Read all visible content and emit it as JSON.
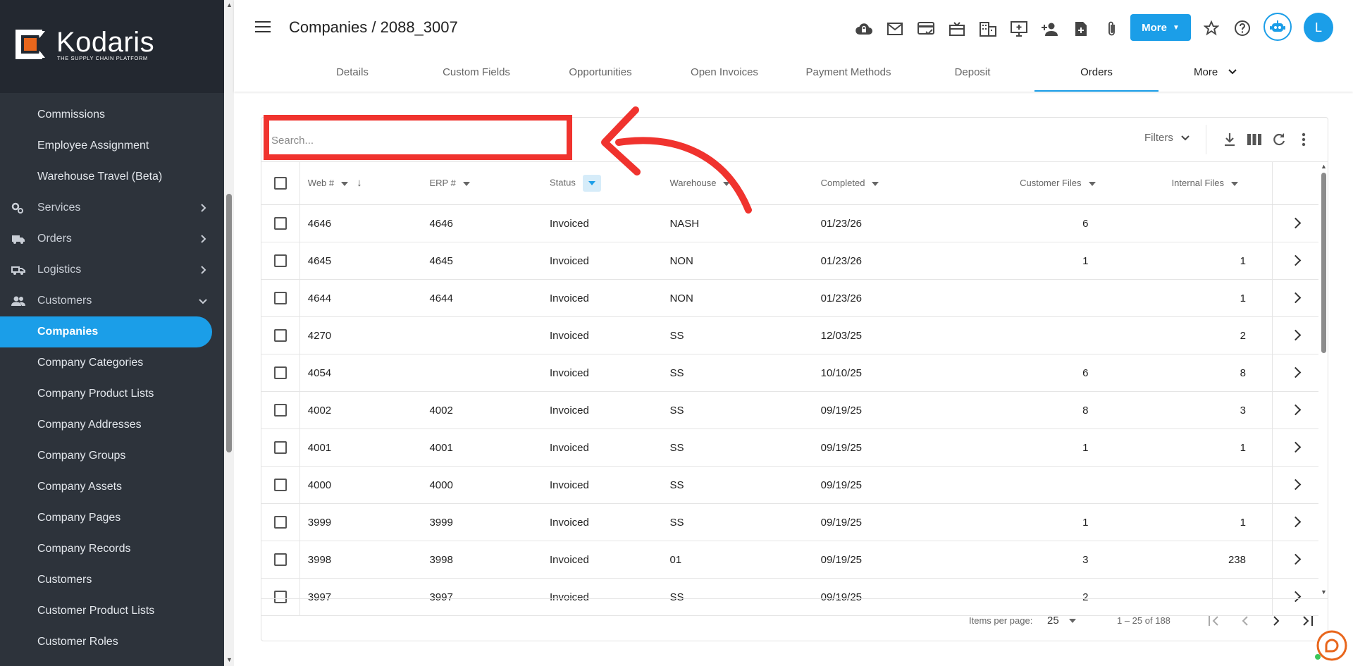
{
  "brand": {
    "name": "Kodaris",
    "tagline": "THE SUPPLY CHAIN PLATFORM",
    "accent": "#1b9ee8"
  },
  "sidebar": {
    "items": [
      {
        "label": "Commissions",
        "type": "sub"
      },
      {
        "label": "Employee Assignment",
        "type": "sub"
      },
      {
        "label": "Warehouse Travel (Beta)",
        "type": "sub"
      },
      {
        "label": "Services",
        "type": "section",
        "icon": "services-icon",
        "expand": "chevron-right-icon"
      },
      {
        "label": "Orders",
        "type": "section",
        "icon": "truck-icon",
        "expand": "chevron-right-icon"
      },
      {
        "label": "Logistics",
        "type": "section",
        "icon": "logistics-icon",
        "expand": "chevron-right-icon"
      },
      {
        "label": "Customers",
        "type": "section",
        "icon": "people-icon",
        "expand": "chevron-down-icon"
      },
      {
        "label": "Companies",
        "type": "active"
      },
      {
        "label": "Company Categories",
        "type": "sub"
      },
      {
        "label": "Company Product Lists",
        "type": "sub"
      },
      {
        "label": "Company Addresses",
        "type": "sub"
      },
      {
        "label": "Company Groups",
        "type": "sub"
      },
      {
        "label": "Company Assets",
        "type": "sub"
      },
      {
        "label": "Company Pages",
        "type": "sub"
      },
      {
        "label": "Company Records",
        "type": "sub"
      },
      {
        "label": "Customers",
        "type": "sub"
      },
      {
        "label": "Customer Product Lists",
        "type": "sub"
      },
      {
        "label": "Customer Roles",
        "type": "sub"
      }
    ]
  },
  "header": {
    "title": "Companies / 2088_3007",
    "more_label": "More",
    "avatar_letter": "L",
    "icons": [
      "cloud-lock-icon",
      "mail-icon",
      "card-check-icon",
      "gift-card-icon",
      "building-icon",
      "monitor-add-icon",
      "person-add-icon",
      "document-add-icon",
      "paperclip-icon"
    ]
  },
  "tabs": [
    {
      "label": "Details"
    },
    {
      "label": "Custom Fields"
    },
    {
      "label": "Opportunities"
    },
    {
      "label": "Open Invoices"
    },
    {
      "label": "Payment Methods"
    },
    {
      "label": "Deposit"
    },
    {
      "label": "Orders",
      "active": true
    }
  ],
  "tabs_more_label": "More",
  "toolbar": {
    "search_placeholder": "Search...",
    "filters_label": "Filters"
  },
  "table": {
    "columns": {
      "web": "Web #",
      "erp": "ERP #",
      "status": "Status",
      "warehouse": "Warehouse",
      "completed": "Completed",
      "customer_files": "Customer Files",
      "internal_files": "Internal Files"
    },
    "rows": [
      {
        "web": "4646",
        "erp": "4646",
        "status": "Invoiced",
        "warehouse": "NASH",
        "completed": "01/23/26",
        "customer_files": "6",
        "internal_files": ""
      },
      {
        "web": "4645",
        "erp": "4645",
        "status": "Invoiced",
        "warehouse": "NON",
        "completed": "01/23/26",
        "customer_files": "1",
        "internal_files": "1"
      },
      {
        "web": "4644",
        "erp": "4644",
        "status": "Invoiced",
        "warehouse": "NON",
        "completed": "01/23/26",
        "customer_files": "",
        "internal_files": "1"
      },
      {
        "web": "4270",
        "erp": "",
        "status": "Invoiced",
        "warehouse": "SS",
        "completed": "12/03/25",
        "customer_files": "",
        "internal_files": "2"
      },
      {
        "web": "4054",
        "erp": "",
        "status": "Invoiced",
        "warehouse": "SS",
        "completed": "10/10/25",
        "customer_files": "6",
        "internal_files": "8"
      },
      {
        "web": "4002",
        "erp": "4002",
        "status": "Invoiced",
        "warehouse": "SS",
        "completed": "09/19/25",
        "customer_files": "8",
        "internal_files": "3"
      },
      {
        "web": "4001",
        "erp": "4001",
        "status": "Invoiced",
        "warehouse": "SS",
        "completed": "09/19/25",
        "customer_files": "1",
        "internal_files": "1"
      },
      {
        "web": "4000",
        "erp": "4000",
        "status": "Invoiced",
        "warehouse": "SS",
        "completed": "09/19/25",
        "customer_files": "",
        "internal_files": ""
      },
      {
        "web": "3999",
        "erp": "3999",
        "status": "Invoiced",
        "warehouse": "SS",
        "completed": "09/19/25",
        "customer_files": "1",
        "internal_files": "1"
      },
      {
        "web": "3998",
        "erp": "3998",
        "status": "Invoiced",
        "warehouse": "01",
        "completed": "09/19/25",
        "customer_files": "3",
        "internal_files": "238"
      },
      {
        "web": "3997",
        "erp": "3997",
        "status": "Invoiced",
        "warehouse": "SS",
        "completed": "09/19/25",
        "customer_files": "2",
        "internal_files": ""
      }
    ]
  },
  "footer": {
    "items_per_page_label": "Items per page:",
    "items_per_page_value": "25",
    "range": "1 – 25 of 188"
  },
  "annotation": {
    "color": "#f0332e"
  }
}
